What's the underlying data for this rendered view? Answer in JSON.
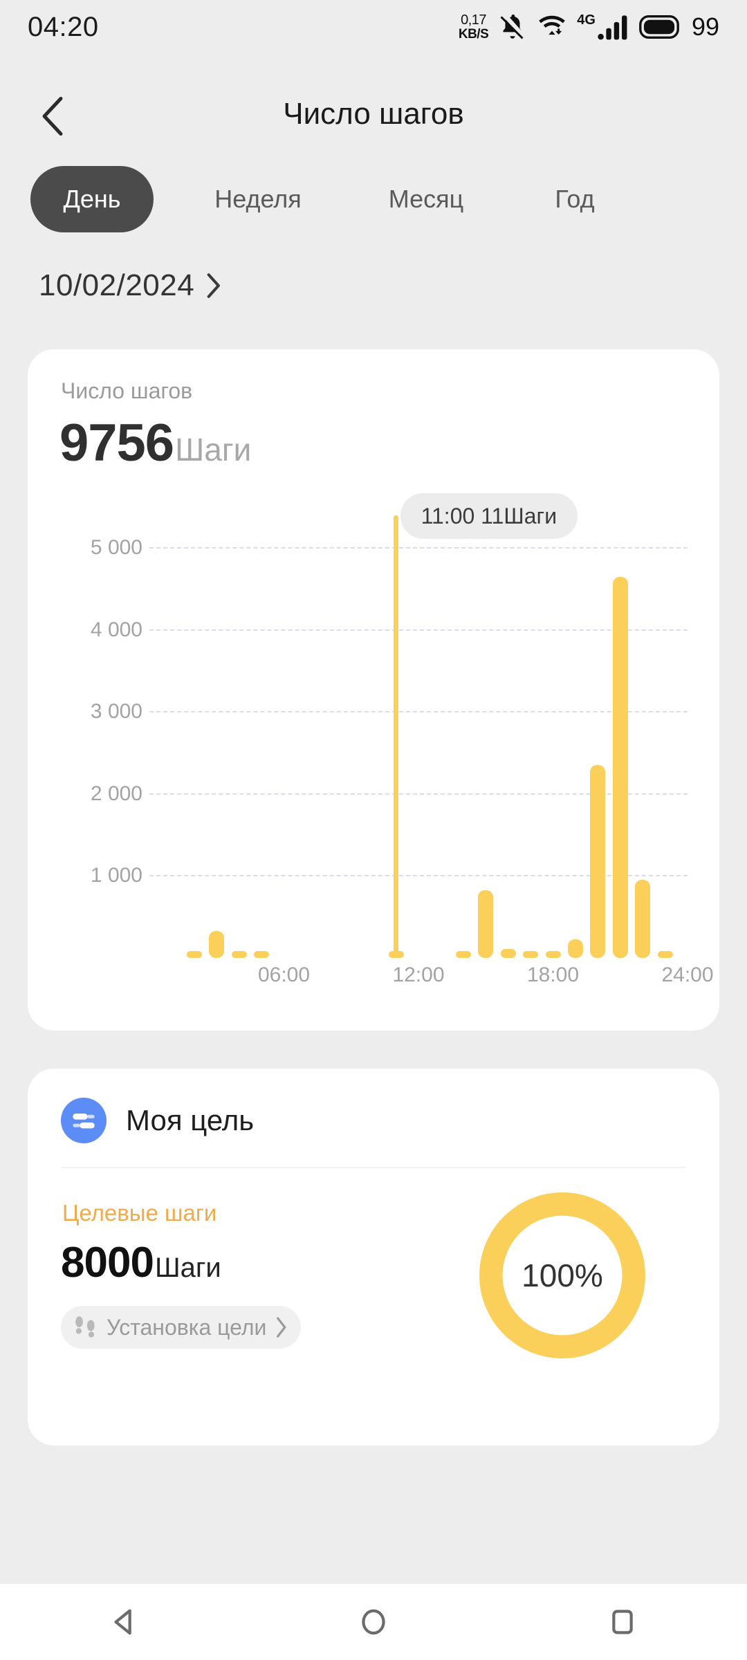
{
  "statusbar": {
    "time": "04:20",
    "net_speed_value": "0,17",
    "net_speed_unit": "KB/S",
    "battery_percent": "99",
    "signal_gen": "4G",
    "icons": [
      "bell-muted-icon",
      "wifi-icon",
      "signal-bars-icon",
      "battery-icon"
    ]
  },
  "header": {
    "title": "Число шагов",
    "back_icon": "chevron-left-icon"
  },
  "tabs": [
    {
      "label": "День",
      "active": true
    },
    {
      "label": "Неделя",
      "active": false
    },
    {
      "label": "Месяц",
      "active": false
    },
    {
      "label": "Год",
      "active": false
    }
  ],
  "date_row": {
    "date": "10/02/2024",
    "chevron_icon": "chevron-right-icon"
  },
  "chart_card": {
    "label": "Число шагов",
    "value": "9756",
    "unit": "Шаги",
    "tooltip": "11:00 11Шаги"
  },
  "goal_card": {
    "title": "Моя цель",
    "icon": "goal-sliders-icon",
    "sub_label": "Целевые шаги",
    "value": "8000",
    "unit": "Шаги",
    "button_label": "Установка цели",
    "button_icon": "footprints-icon",
    "button_chevron": "chevron-right-icon",
    "progress_text": "100%",
    "accent_color": "#fbd05a",
    "sub_label_color": "#f0ab4b",
    "icon_bg_color": "#5c8cf5"
  },
  "navbar": {
    "back_icon": "triangle-back-icon",
    "home_icon": "circle-home-icon",
    "recents_icon": "square-recents-icon"
  },
  "chart_data": {
    "type": "bar",
    "title": "Число шагов",
    "xlabel": "",
    "ylabel": "",
    "ylim": [
      0,
      5400
    ],
    "xlim": [
      0,
      24
    ],
    "grid": true,
    "gridlines": [
      1000,
      2000,
      3000,
      4000,
      5000
    ],
    "ytick_labels": [
      "1 000",
      "2 000",
      "3 000",
      "4 000",
      "5 000"
    ],
    "xtick_values": [
      6,
      12,
      18,
      24
    ],
    "xtick_labels": [
      "06:00",
      "12:00",
      "18:00",
      "24:00"
    ],
    "bar_color": "#fbd05a",
    "total": 9756,
    "unit": "Шаги",
    "selected": {
      "hour": 11,
      "time": "11:00",
      "value": 11,
      "unit": "Шаги"
    },
    "x": [
      2,
      3,
      4,
      5,
      11,
      14,
      15,
      16,
      17,
      18,
      19,
      20,
      21,
      22,
      23
    ],
    "values": [
      40,
      330,
      70,
      70,
      11,
      60,
      830,
      110,
      40,
      50,
      230,
      2350,
      4650,
      950,
      80
    ],
    "categories": [
      "02:00",
      "03:00",
      "04:00",
      "05:00",
      "11:00",
      "14:00",
      "15:00",
      "16:00",
      "17:00",
      "18:00",
      "19:00",
      "20:00",
      "21:00",
      "22:00",
      "23:00"
    ]
  }
}
